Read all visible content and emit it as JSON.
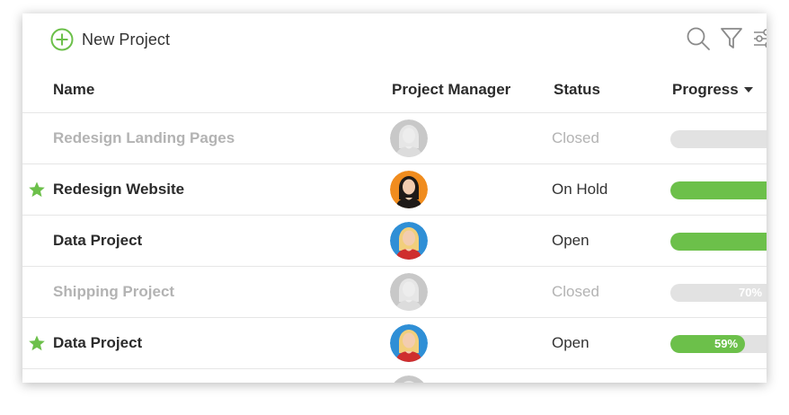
{
  "toolbar": {
    "new_project_label": "New Project",
    "icons": [
      "plus-circle-icon",
      "search-icon",
      "filter-icon",
      "sliders-icon"
    ]
  },
  "table": {
    "columns": {
      "name": "Name",
      "manager": "Project Manager",
      "status": "Status",
      "progress": "Progress"
    },
    "sort_column": "Progress",
    "rows": [
      {
        "name": "Redesign Landing Pages",
        "status": "Closed",
        "starred": false,
        "progress": 1.0,
        "progress_label": "",
        "avatar": "avatar-blonde-grayscale"
      },
      {
        "name": "Redesign Website",
        "status": "On Hold",
        "starred": true,
        "progress": 1.0,
        "progress_label": "",
        "avatar": "avatar-dark-hair-orange"
      },
      {
        "name": "Data Project",
        "status": "Open",
        "starred": false,
        "progress": 1.0,
        "progress_label": "",
        "avatar": "avatar-blonde-blue"
      },
      {
        "name": "Shipping Project",
        "status": "Closed",
        "starred": false,
        "progress": 0.7,
        "progress_label": "70%",
        "avatar": "avatar-blonde-grayscale"
      },
      {
        "name": "Data Project",
        "status": "Open",
        "starred": true,
        "progress": 0.59,
        "progress_label": "59%",
        "avatar": "avatar-blonde-blue"
      }
    ]
  },
  "colors": {
    "accent_green": "#6cc04a",
    "track_gray": "#e2e2e2",
    "muted_text": "#b3b3b3",
    "star": "#6cc04a",
    "avatar_orange": "#f08c1e",
    "avatar_blue": "#2f8fd6"
  }
}
